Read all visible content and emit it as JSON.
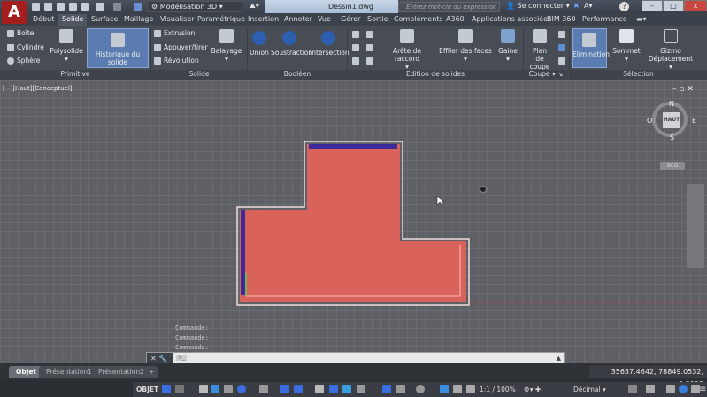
{
  "app": {
    "logo": "A",
    "workspace": "Modélisation 3D",
    "document": "Dessin1.dwg",
    "search_placeholder": "Entrez mot-clé ou expression",
    "sign_in": "Se connecter",
    "help": "?"
  },
  "tabs": [
    "Début",
    "Solide",
    "Surface",
    "Maillage",
    "Visualiser",
    "Paramétrique",
    "Insertion",
    "Annoter",
    "Vue",
    "Gérer",
    "Sortie",
    "Compléments",
    "A360",
    "Applications associées",
    "BIM 360",
    "Performance"
  ],
  "active_tab": "Solide",
  "ribbon": {
    "primitive": {
      "title": "Primitive",
      "small": [
        "Boîte",
        "Cylindre",
        "Sphère"
      ],
      "polysolide": "Polysolide",
      "historique": "Historique du solide"
    },
    "solide": {
      "title": "Solide",
      "small": [
        "Extrusion",
        "Appuyer/tirer",
        "Révolution"
      ],
      "balayage": "Balayage"
    },
    "booleen": {
      "title": "Booléen",
      "items": [
        "Union",
        "Soustraction",
        "Intersection"
      ]
    },
    "edition": {
      "title": "Edition de solides",
      "items": [
        "Arête de raccord",
        "Effiler des faces",
        "Gaine"
      ]
    },
    "coupe": {
      "title": "Coupe",
      "plan": "Plan",
      "plan2": "de coupe"
    },
    "selection": {
      "title": "Sélection",
      "items": [
        "Elimination",
        "Sommet"
      ],
      "gizmo": "Gizmo",
      "gizmo2": "Déplacement"
    }
  },
  "viewport": {
    "label": "[−][Haut][Conceptuel]",
    "viewcube": {
      "top": "HAUT",
      "n": "N",
      "s": "S",
      "e": "E",
      "w": "O",
      "ucs": "SCG"
    },
    "colors": {
      "fill": "#d9625a",
      "edge": "#3a2a9a"
    }
  },
  "command": {
    "history": [
      "Commande:",
      "Commande:",
      "Commande:"
    ],
    "prompt": ">_"
  },
  "layout_tabs": [
    "Objet",
    "Présentation1",
    "Présentation2",
    "+"
  ],
  "coords": "35637.4642, 78849.0532, 0.0000",
  "status": {
    "objet": "OBJET",
    "scale": "1:1 / 100%",
    "units": "Décimal"
  }
}
